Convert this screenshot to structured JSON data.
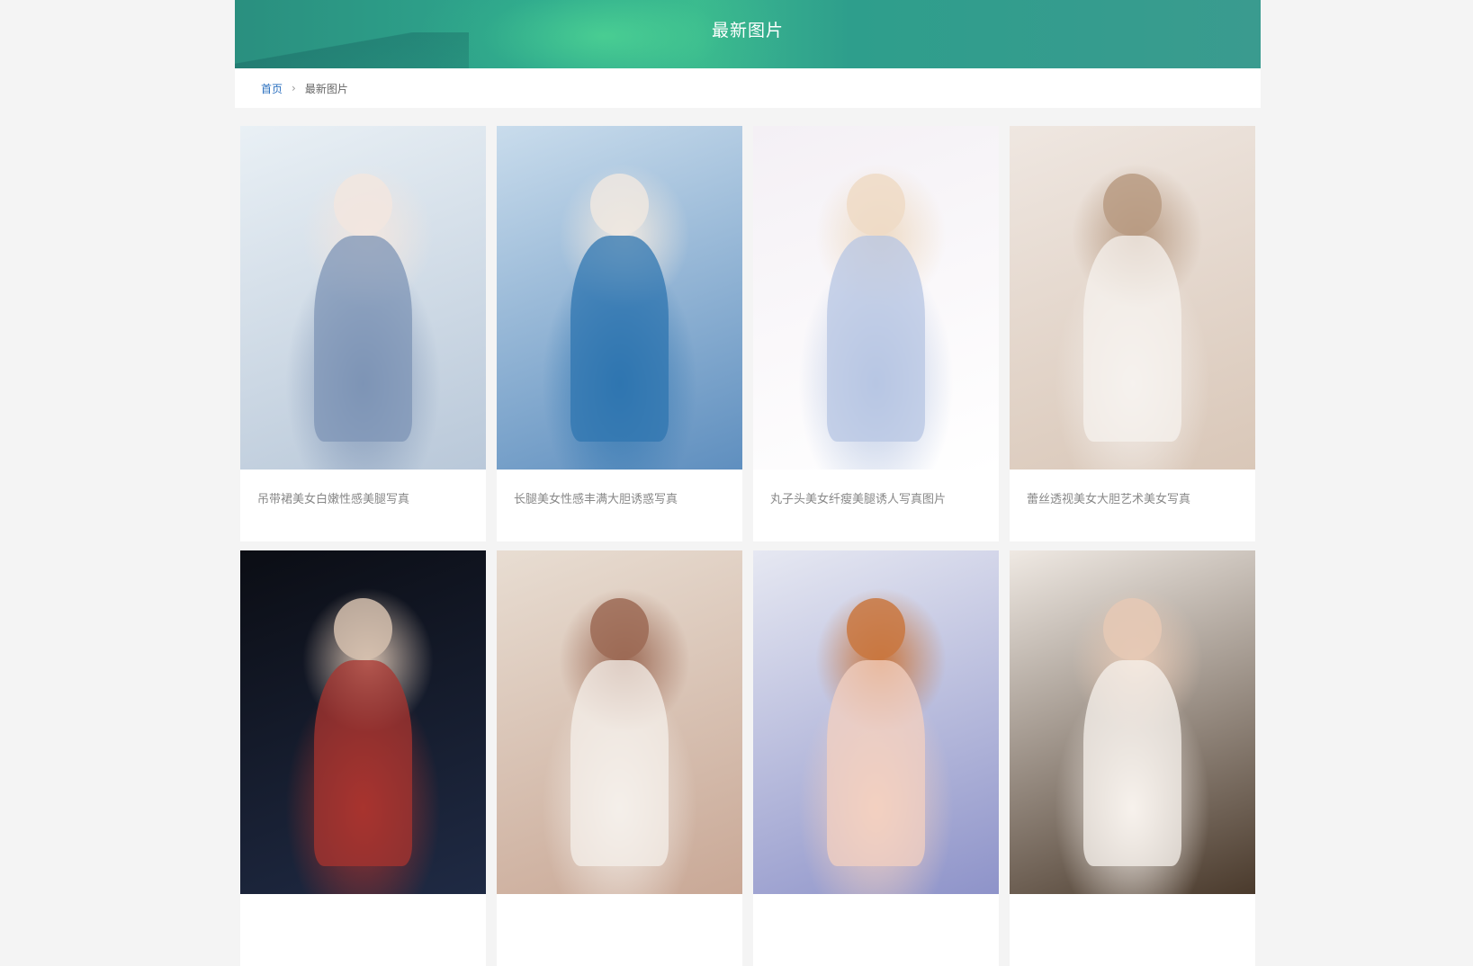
{
  "header": {
    "title": "最新图片"
  },
  "breadcrumb": {
    "home": "首页",
    "separator": "›",
    "current": "最新图片"
  },
  "gallery": {
    "items": [
      {
        "caption": "吊带裙美女白嫩性感美腿写真",
        "photo_palette": [
          "#e9f0f5",
          "#b9c8d9",
          "#7d94b5",
          "#f2e6df"
        ]
      },
      {
        "caption": "长腿美女性感丰满大胆诱惑写真",
        "photo_palette": [
          "#c9dcec",
          "#5f8fbf",
          "#2f75b0",
          "#efe8e0"
        ]
      },
      {
        "caption": "丸子头美女纤瘦美腿诱人写真图片",
        "photo_palette": [
          "#f4f0f5",
          "#ffffff",
          "#b7c6e3",
          "#eedbc5"
        ]
      },
      {
        "caption": "蕾丝透视美女大胆艺术美女写真",
        "photo_palette": [
          "#efe7e1",
          "#d9c7b8",
          "#f5f1ee",
          "#b89b83"
        ]
      },
      {
        "caption": "",
        "photo_palette": [
          "#0b0d14",
          "#1f2a44",
          "#a8342f",
          "#d5bfae"
        ]
      },
      {
        "caption": "",
        "photo_palette": [
          "#e8ddd2",
          "#c9a896",
          "#f4efea",
          "#9c6a55"
        ]
      },
      {
        "caption": "",
        "photo_palette": [
          "#e6e8f2",
          "#8e93c9",
          "#f3d0c0",
          "#c9773f"
        ]
      },
      {
        "caption": "",
        "photo_palette": [
          "#efe9e3",
          "#4a3a2c",
          "#f7f1ec",
          "#e6c9b5"
        ]
      }
    ]
  }
}
